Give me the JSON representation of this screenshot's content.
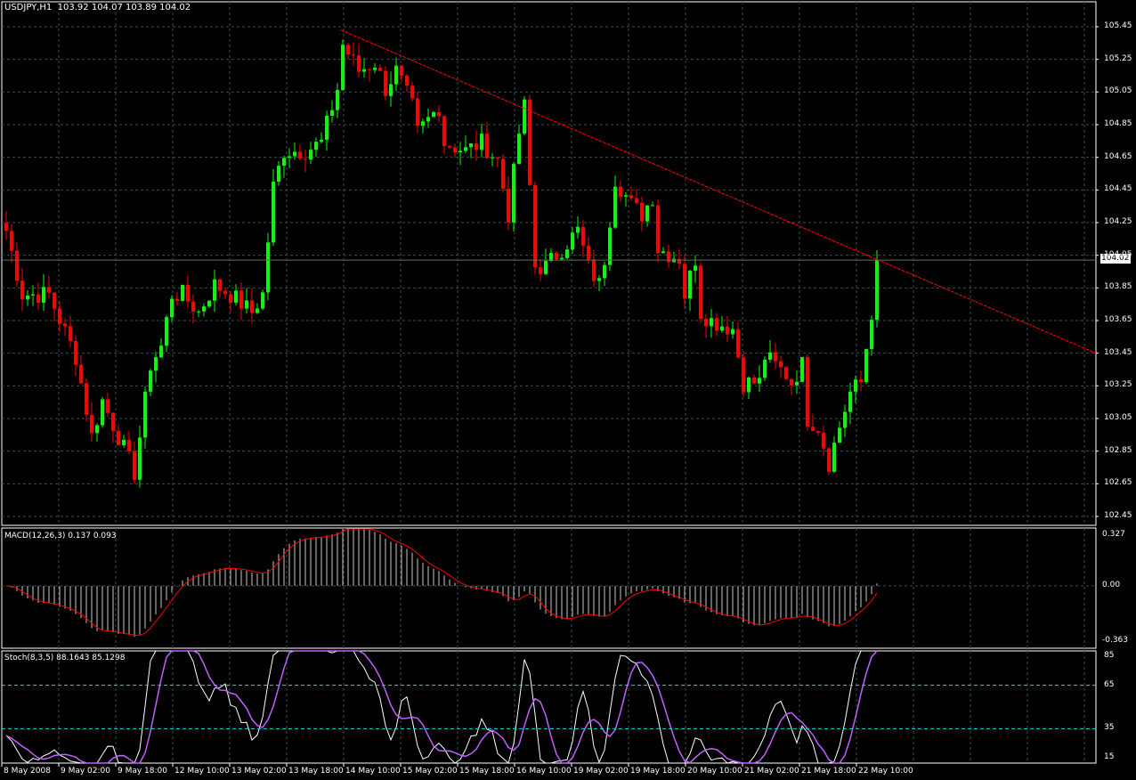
{
  "header": {
    "symbol": "USDJPY,H1",
    "ohlc": "103.92 104.07 103.89 104.02"
  },
  "colors": {
    "bull": "#00ff00",
    "bear": "#ff0000",
    "trendline": "#ff0000",
    "stoch_main": "#ffffff",
    "stoch_signal": "#c060ff",
    "levels": "#00e0e0",
    "grid": "#2f4f4f"
  },
  "price_axis": {
    "labels": [
      "105.45",
      "105.25",
      "105.05",
      "104.85",
      "104.65",
      "104.45",
      "104.25",
      "104.05",
      "103.85",
      "103.65",
      "103.45",
      "103.25",
      "103.05",
      "102.85",
      "102.65",
      "102.45"
    ],
    "current": "104.02"
  },
  "macd": {
    "title": "MACD(12,26,3) 0.137 0.093",
    "axis": [
      "0.327",
      "0.00",
      "-0.363"
    ]
  },
  "stoch": {
    "title": "Stoch(8,3,5) 88.1643 85.1298",
    "axis": [
      "85",
      "65",
      "35",
      "15"
    ]
  },
  "time_axis": [
    "8 May 2008",
    "9 May 02:00",
    "9 May 18:00",
    "12 May 10:00",
    "13 May 02:00",
    "13 May 18:00",
    "14 May 10:00",
    "15 May 02:00",
    "15 May 18:00",
    "16 May 10:00",
    "19 May 02:00",
    "19 May 18:00",
    "20 May 10:00",
    "21 May 02:00",
    "21 May 18:00",
    "22 May 10:00"
  ],
  "chart_data": {
    "type": "candlestick",
    "symbol": "USDJPY",
    "timeframe": "H1",
    "ylim": [
      102.45,
      105.45
    ],
    "close_path": [
      [
        0,
        104.2
      ],
      [
        3,
        103.81
      ],
      [
        8,
        103.81
      ],
      [
        13,
        103.43
      ],
      [
        16,
        102.94
      ],
      [
        18,
        103.16
      ],
      [
        21,
        102.94
      ],
      [
        24,
        102.72
      ],
      [
        27,
        103.38
      ],
      [
        29,
        103.49
      ],
      [
        31,
        103.81
      ],
      [
        33,
        103.81
      ],
      [
        36,
        103.7
      ],
      [
        39,
        103.87
      ],
      [
        42,
        103.81
      ],
      [
        46,
        103.7
      ],
      [
        48,
        103.81
      ],
      [
        50,
        104.47
      ],
      [
        52,
        104.69
      ],
      [
        56,
        104.69
      ],
      [
        59,
        104.74
      ],
      [
        62,
        105.07
      ],
      [
        63,
        105.34
      ],
      [
        66,
        105.18
      ],
      [
        69,
        105.23
      ],
      [
        71,
        105.07
      ],
      [
        73,
        105.18
      ],
      [
        76,
        104.96
      ],
      [
        77,
        104.8
      ],
      [
        81,
        104.96
      ],
      [
        82,
        104.74
      ],
      [
        86,
        104.69
      ],
      [
        89,
        104.74
      ],
      [
        92,
        104.63
      ],
      [
        94,
        104.3
      ],
      [
        96,
        104.8
      ],
      [
        97,
        104.96
      ],
      [
        99,
        103.98
      ],
      [
        101,
        103.98
      ],
      [
        104,
        104.09
      ],
      [
        107,
        104.2
      ],
      [
        109,
        103.98
      ],
      [
        111,
        103.87
      ],
      [
        112,
        104.03
      ],
      [
        114,
        104.52
      ],
      [
        117,
        104.36
      ],
      [
        119,
        104.3
      ],
      [
        121,
        104.41
      ],
      [
        122,
        104.09
      ],
      [
        126,
        104.03
      ],
      [
        127,
        103.81
      ],
      [
        129,
        104.03
      ],
      [
        130,
        103.7
      ],
      [
        132,
        103.65
      ],
      [
        136,
        103.6
      ],
      [
        138,
        103.27
      ],
      [
        141,
        103.27
      ],
      [
        142,
        103.43
      ],
      [
        146,
        103.32
      ],
      [
        147,
        103.27
      ],
      [
        149,
        103.38
      ],
      [
        150,
        103.05
      ],
      [
        152,
        103.0
      ],
      [
        154,
        102.78
      ],
      [
        156,
        103.0
      ],
      [
        158,
        103.21
      ],
      [
        160,
        103.27
      ],
      [
        162,
        103.7
      ],
      [
        163,
        104.02
      ]
    ],
    "trendline": {
      "from_price": 105.43,
      "to_price": 103.45
    },
    "bid_line": 104.02
  }
}
